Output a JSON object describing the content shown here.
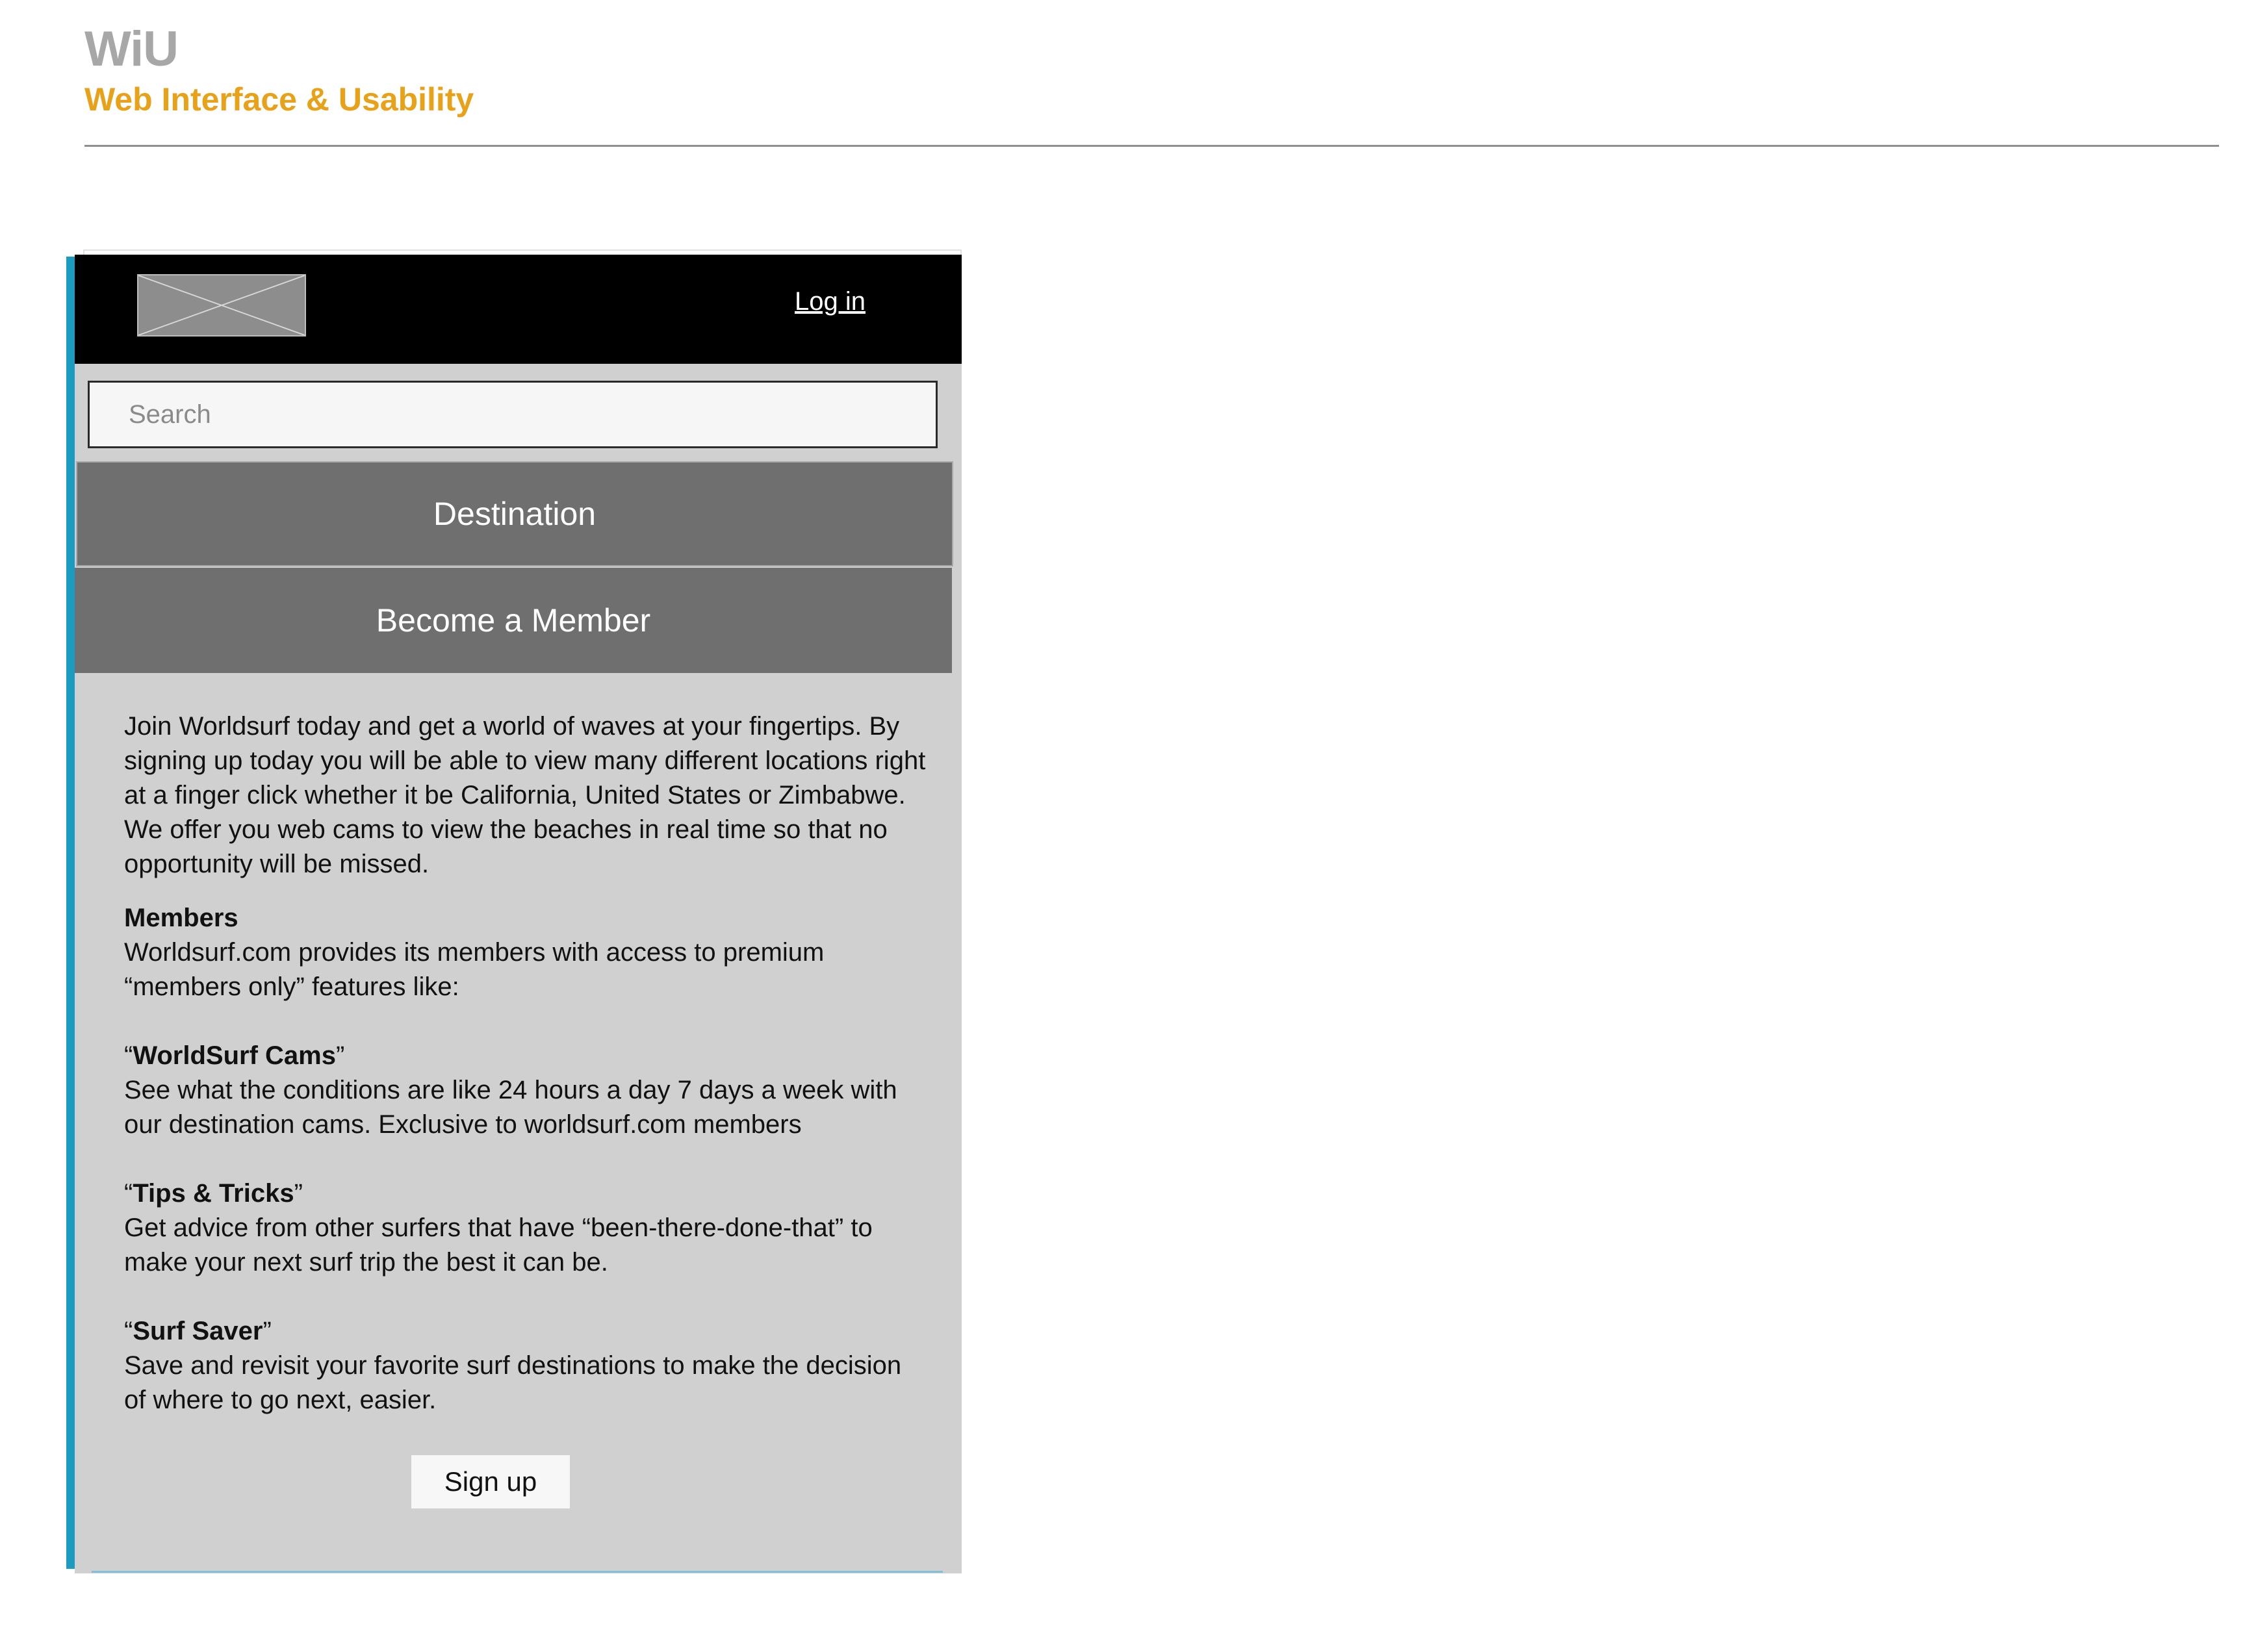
{
  "header": {
    "brand_title": "WiU",
    "brand_subtitle": "Web Interface & Usability"
  },
  "mockup": {
    "topbar": {
      "logo_icon": "image-placeholder-icon",
      "login_label": "Log in"
    },
    "search": {
      "placeholder": "Search",
      "value": ""
    },
    "nav": {
      "destination_label": "Destination",
      "member_label": "Become a Member"
    },
    "intro_text": "Join Worldsurf today and get a world of waves at your fingertips. By signing up today you will be able to view many different locations right at a finger click whether it be California, United States or Zimbabwe. We offer you web cams to view the beaches in real time so that no opportunity will be missed.",
    "members": {
      "title": "Members",
      "text": "Worldsurf.com provides its members with access to premium “members only” features like:"
    },
    "features": [
      {
        "open_quote": "“",
        "name": "WorldSurf Cams",
        "close_quote": "”",
        "description": "See what the conditions are like 24 hours a day 7 days a week with our destination cams. Exclusive to worldsurf.com members"
      },
      {
        "open_quote": "“",
        "name": "Tips & Tricks",
        "close_quote": "”",
        "description": "Get advice from other surfers that have “been-there-done-that” to make your next surf trip the best it can be."
      },
      {
        "open_quote": "“",
        "name": "Surf Saver",
        "close_quote": "”",
        "description": "Save and revisit your favorite surf destinations to make the decision of where to go next, easier."
      }
    ],
    "signup_label": "Sign up"
  },
  "colors": {
    "brand_grey": "#a7a7a7",
    "brand_orange": "#e8a21a",
    "accent_blue": "#1a9bbf",
    "nav_grey": "#6f6f6f",
    "panel_grey": "#d0d0d0"
  }
}
